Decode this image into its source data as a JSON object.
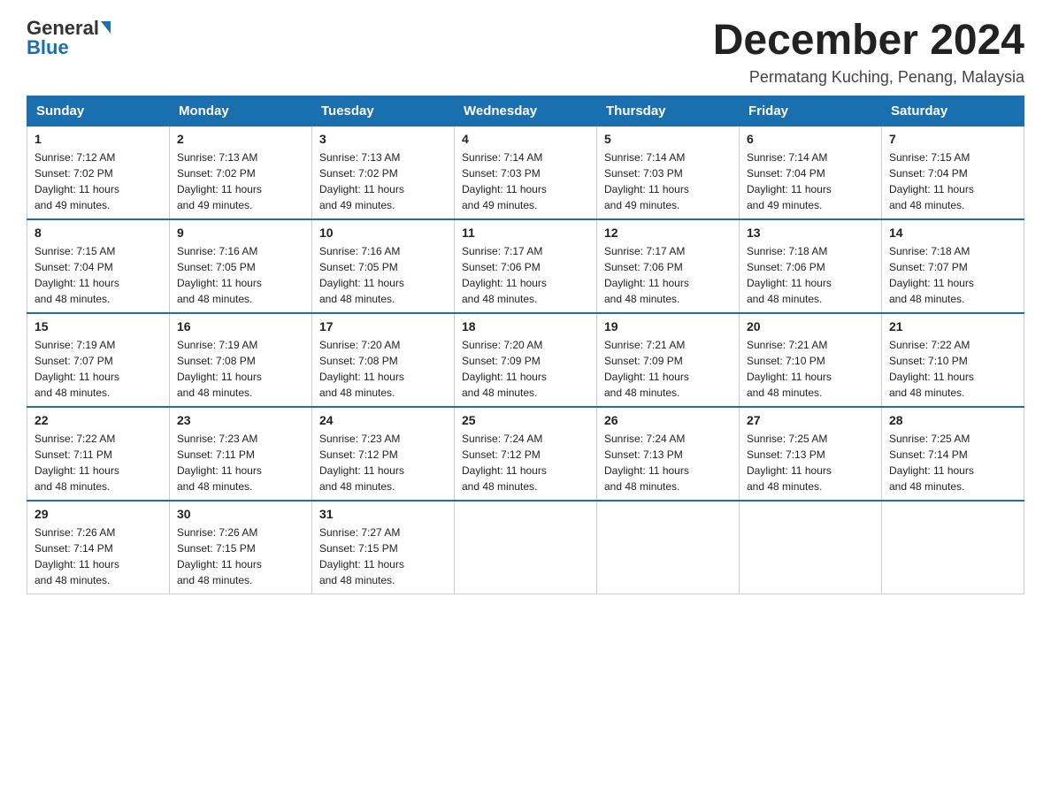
{
  "header": {
    "logo_general": "General",
    "logo_blue": "Blue",
    "month_title": "December 2024",
    "location": "Permatang Kuching, Penang, Malaysia"
  },
  "days_of_week": [
    "Sunday",
    "Monday",
    "Tuesday",
    "Wednesday",
    "Thursday",
    "Friday",
    "Saturday"
  ],
  "weeks": [
    [
      {
        "day": "1",
        "sunrise": "7:12 AM",
        "sunset": "7:02 PM",
        "daylight": "11 hours and 49 minutes."
      },
      {
        "day": "2",
        "sunrise": "7:13 AM",
        "sunset": "7:02 PM",
        "daylight": "11 hours and 49 minutes."
      },
      {
        "day": "3",
        "sunrise": "7:13 AM",
        "sunset": "7:02 PM",
        "daylight": "11 hours and 49 minutes."
      },
      {
        "day": "4",
        "sunrise": "7:14 AM",
        "sunset": "7:03 PM",
        "daylight": "11 hours and 49 minutes."
      },
      {
        "day": "5",
        "sunrise": "7:14 AM",
        "sunset": "7:03 PM",
        "daylight": "11 hours and 49 minutes."
      },
      {
        "day": "6",
        "sunrise": "7:14 AM",
        "sunset": "7:04 PM",
        "daylight": "11 hours and 49 minutes."
      },
      {
        "day": "7",
        "sunrise": "7:15 AM",
        "sunset": "7:04 PM",
        "daylight": "11 hours and 48 minutes."
      }
    ],
    [
      {
        "day": "8",
        "sunrise": "7:15 AM",
        "sunset": "7:04 PM",
        "daylight": "11 hours and 48 minutes."
      },
      {
        "day": "9",
        "sunrise": "7:16 AM",
        "sunset": "7:05 PM",
        "daylight": "11 hours and 48 minutes."
      },
      {
        "day": "10",
        "sunrise": "7:16 AM",
        "sunset": "7:05 PM",
        "daylight": "11 hours and 48 minutes."
      },
      {
        "day": "11",
        "sunrise": "7:17 AM",
        "sunset": "7:06 PM",
        "daylight": "11 hours and 48 minutes."
      },
      {
        "day": "12",
        "sunrise": "7:17 AM",
        "sunset": "7:06 PM",
        "daylight": "11 hours and 48 minutes."
      },
      {
        "day": "13",
        "sunrise": "7:18 AM",
        "sunset": "7:06 PM",
        "daylight": "11 hours and 48 minutes."
      },
      {
        "day": "14",
        "sunrise": "7:18 AM",
        "sunset": "7:07 PM",
        "daylight": "11 hours and 48 minutes."
      }
    ],
    [
      {
        "day": "15",
        "sunrise": "7:19 AM",
        "sunset": "7:07 PM",
        "daylight": "11 hours and 48 minutes."
      },
      {
        "day": "16",
        "sunrise": "7:19 AM",
        "sunset": "7:08 PM",
        "daylight": "11 hours and 48 minutes."
      },
      {
        "day": "17",
        "sunrise": "7:20 AM",
        "sunset": "7:08 PM",
        "daylight": "11 hours and 48 minutes."
      },
      {
        "day": "18",
        "sunrise": "7:20 AM",
        "sunset": "7:09 PM",
        "daylight": "11 hours and 48 minutes."
      },
      {
        "day": "19",
        "sunrise": "7:21 AM",
        "sunset": "7:09 PM",
        "daylight": "11 hours and 48 minutes."
      },
      {
        "day": "20",
        "sunrise": "7:21 AM",
        "sunset": "7:10 PM",
        "daylight": "11 hours and 48 minutes."
      },
      {
        "day": "21",
        "sunrise": "7:22 AM",
        "sunset": "7:10 PM",
        "daylight": "11 hours and 48 minutes."
      }
    ],
    [
      {
        "day": "22",
        "sunrise": "7:22 AM",
        "sunset": "7:11 PM",
        "daylight": "11 hours and 48 minutes."
      },
      {
        "day": "23",
        "sunrise": "7:23 AM",
        "sunset": "7:11 PM",
        "daylight": "11 hours and 48 minutes."
      },
      {
        "day": "24",
        "sunrise": "7:23 AM",
        "sunset": "7:12 PM",
        "daylight": "11 hours and 48 minutes."
      },
      {
        "day": "25",
        "sunrise": "7:24 AM",
        "sunset": "7:12 PM",
        "daylight": "11 hours and 48 minutes."
      },
      {
        "day": "26",
        "sunrise": "7:24 AM",
        "sunset": "7:13 PM",
        "daylight": "11 hours and 48 minutes."
      },
      {
        "day": "27",
        "sunrise": "7:25 AM",
        "sunset": "7:13 PM",
        "daylight": "11 hours and 48 minutes."
      },
      {
        "day": "28",
        "sunrise": "7:25 AM",
        "sunset": "7:14 PM",
        "daylight": "11 hours and 48 minutes."
      }
    ],
    [
      {
        "day": "29",
        "sunrise": "7:26 AM",
        "sunset": "7:14 PM",
        "daylight": "11 hours and 48 minutes."
      },
      {
        "day": "30",
        "sunrise": "7:26 AM",
        "sunset": "7:15 PM",
        "daylight": "11 hours and 48 minutes."
      },
      {
        "day": "31",
        "sunrise": "7:27 AM",
        "sunset": "7:15 PM",
        "daylight": "11 hours and 48 minutes."
      },
      null,
      null,
      null,
      null
    ]
  ],
  "labels": {
    "sunrise": "Sunrise:",
    "sunset": "Sunset:",
    "daylight": "Daylight:"
  }
}
